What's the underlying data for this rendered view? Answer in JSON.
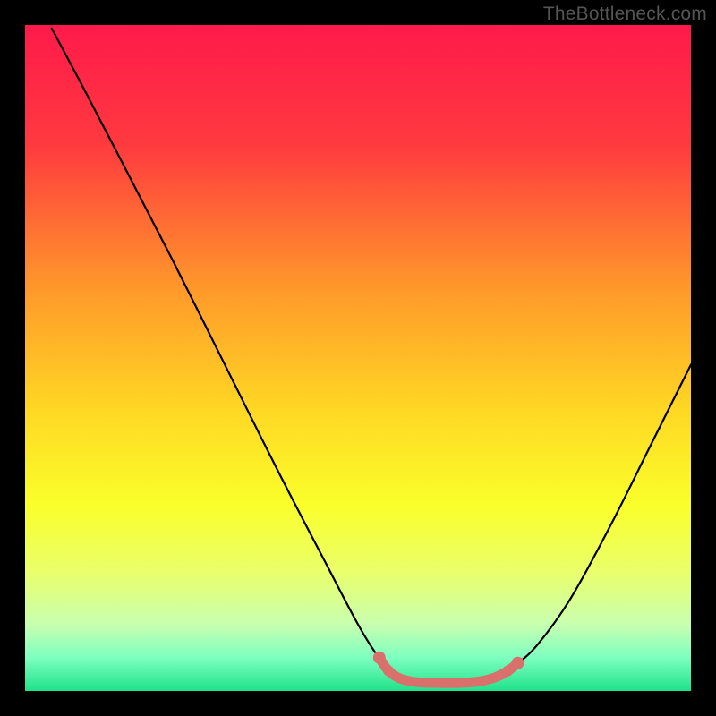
{
  "watermark": "TheBottleneck.com",
  "chart_data": {
    "type": "line",
    "title": "",
    "xlabel": "",
    "ylabel": "",
    "xlim": [
      0,
      100
    ],
    "ylim": [
      0,
      100
    ],
    "gradient_stops": [
      {
        "offset": 0,
        "color": "#ff1a4b"
      },
      {
        "offset": 18,
        "color": "#ff3a3f"
      },
      {
        "offset": 40,
        "color": "#ff9a2a"
      },
      {
        "offset": 58,
        "color": "#ffd824"
      },
      {
        "offset": 72,
        "color": "#faff2a"
      },
      {
        "offset": 82,
        "color": "#eaff6a"
      },
      {
        "offset": 90,
        "color": "#c8ffb0"
      },
      {
        "offset": 95,
        "color": "#7dffc0"
      },
      {
        "offset": 100,
        "color": "#1fe28a"
      }
    ],
    "series": [
      {
        "name": "bottleneck-curve",
        "color": "#000000",
        "points": [
          {
            "x": 4.0,
            "y": 99.5
          },
          {
            "x": 8.0,
            "y": 92.0
          },
          {
            "x": 14.0,
            "y": 80.5
          },
          {
            "x": 22.0,
            "y": 65.0
          },
          {
            "x": 30.0,
            "y": 49.0
          },
          {
            "x": 38.0,
            "y": 33.0
          },
          {
            "x": 45.0,
            "y": 19.5
          },
          {
            "x": 50.0,
            "y": 10.0
          },
          {
            "x": 53.0,
            "y": 5.2
          },
          {
            "x": 55.0,
            "y": 3.2
          },
          {
            "x": 57.0,
            "y": 2.2
          },
          {
            "x": 60.0,
            "y": 1.5
          },
          {
            "x": 64.0,
            "y": 1.3
          },
          {
            "x": 68.0,
            "y": 1.6
          },
          {
            "x": 71.0,
            "y": 2.4
          },
          {
            "x": 73.5,
            "y": 3.8
          },
          {
            "x": 77.0,
            "y": 7.0
          },
          {
            "x": 82.0,
            "y": 14.0
          },
          {
            "x": 88.0,
            "y": 25.0
          },
          {
            "x": 94.0,
            "y": 37.0
          },
          {
            "x": 100.0,
            "y": 49.0
          }
        ]
      },
      {
        "name": "optimal-marker",
        "color": "#d9706c",
        "points": [
          {
            "x": 53.2,
            "y": 5.0
          },
          {
            "x": 54.6,
            "y": 3.0
          },
          {
            "x": 56.5,
            "y": 1.8
          },
          {
            "x": 59.0,
            "y": 1.3
          },
          {
            "x": 62.0,
            "y": 1.2
          },
          {
            "x": 65.0,
            "y": 1.2
          },
          {
            "x": 68.0,
            "y": 1.4
          },
          {
            "x": 70.5,
            "y": 2.0
          },
          {
            "x": 72.5,
            "y": 3.0
          },
          {
            "x": 74.0,
            "y": 4.2
          }
        ]
      }
    ]
  }
}
